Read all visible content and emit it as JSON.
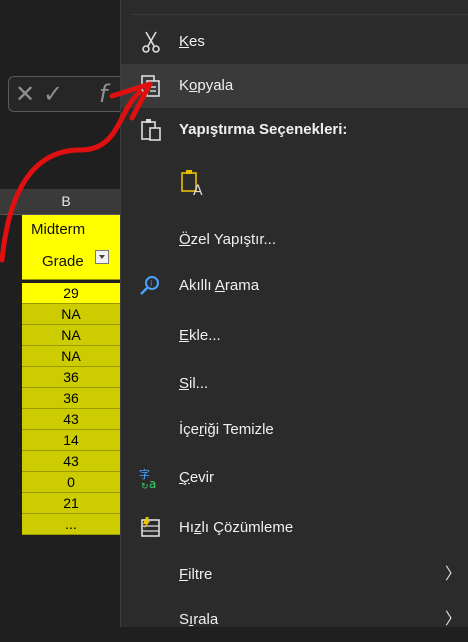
{
  "sheet": {
    "column_letter": "B",
    "header": {
      "line1": "Midterm",
      "line2": "Grade"
    },
    "cells": [
      "29",
      "NA",
      "NA",
      "NA",
      "36",
      "36",
      "43",
      "14",
      "43",
      "0",
      "21",
      "..."
    ]
  },
  "menu": {
    "cut": {
      "pre": "",
      "key": "K",
      "post": "es"
    },
    "copy": {
      "pre": "K",
      "key": "o",
      "post": "pyala"
    },
    "paste_header": "Yapıştırma Seçenekleri:",
    "paste_special": {
      "pre": "",
      "key": "Ö",
      "post": "zel Yapıştır..."
    },
    "smart_lookup": {
      "pre": "Akıllı ",
      "key": "A",
      "post": "rama"
    },
    "insert": {
      "pre": "",
      "key": "E",
      "post": "kle..."
    },
    "delete": {
      "pre": "",
      "key": "S",
      "post": "il..."
    },
    "clear": {
      "pre": "İçe",
      "key": "r",
      "post": "iği Temizle"
    },
    "translate": {
      "pre": "",
      "key": "Ç",
      "post": "evir"
    },
    "quick_analysis": {
      "pre": "Hı",
      "key": "z",
      "post": "lı Çözümleme"
    },
    "filter": {
      "pre": "",
      "key": "F",
      "post": "iltre"
    },
    "sort": {
      "pre": "S",
      "key": "ı",
      "post": "rala"
    }
  },
  "colors": {
    "highlight": "#ffff00",
    "cell_fill": "#cccc00",
    "arrow": "#e01010",
    "menu_bg": "#2b2b2b"
  }
}
